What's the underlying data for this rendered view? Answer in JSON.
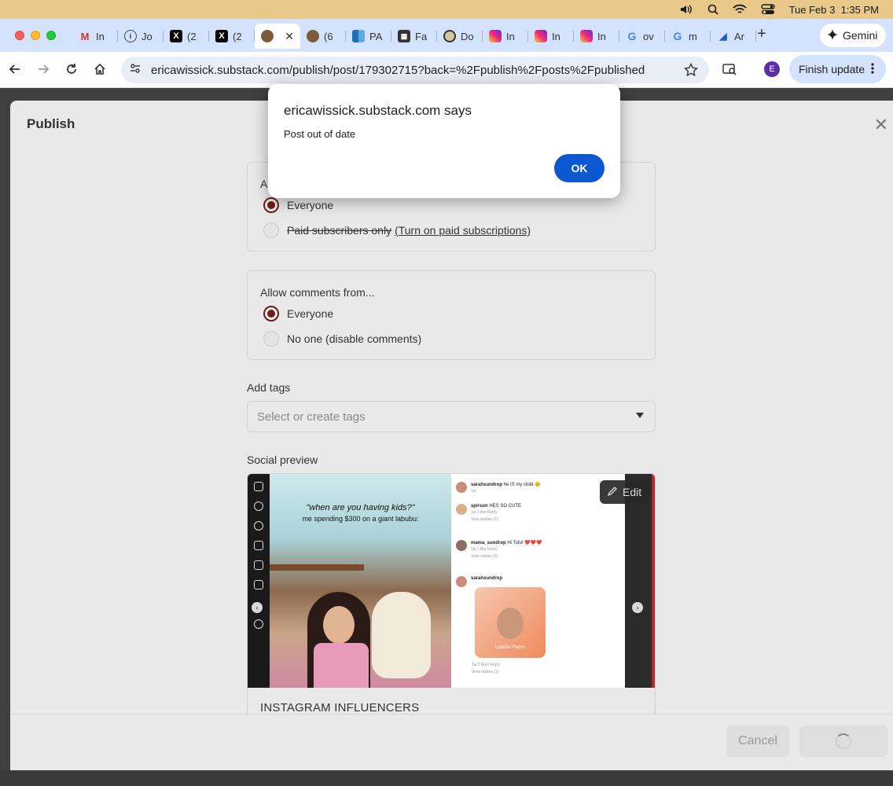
{
  "menubar": {
    "datetime": "Tue Feb 3  1:35 PM"
  },
  "tabs": [
    {
      "label": "In",
      "icon": "gmail-icon"
    },
    {
      "label": "Jo",
      "icon": "info-icon"
    },
    {
      "label": "(2",
      "icon": "x-icon"
    },
    {
      "label": "(2",
      "icon": "x-icon"
    },
    {
      "label": "",
      "icon": "cat-icon",
      "active": true
    },
    {
      "label": "(6",
      "icon": "cat-icon"
    },
    {
      "label": "PA",
      "icon": "grid-icon"
    },
    {
      "label": "Fa",
      "icon": "calendar-icon"
    },
    {
      "label": "Do",
      "icon": "owl-icon"
    },
    {
      "label": "In",
      "icon": "instagram-icon"
    },
    {
      "label": "In",
      "icon": "instagram-icon"
    },
    {
      "label": "In",
      "icon": "instagram-icon"
    },
    {
      "label": "ov",
      "icon": "google-icon"
    },
    {
      "label": "m",
      "icon": "google-icon"
    },
    {
      "label": "Ar",
      "icon": "azure-icon"
    }
  ],
  "browser": {
    "gemini_label": "Gemini",
    "url": "ericawissick.substack.com/publish/post/179302715?back=%2Fpublish%2Fposts%2Fpublished",
    "avatar_letter": "E",
    "finish_update_label": "Finish update"
  },
  "modal": {
    "title": "Publish",
    "audience": {
      "heading_partial": "A",
      "option_everyone": "Everyone",
      "option_paid": "Paid subscribers only",
      "paid_link": "(Turn on paid subscriptions)"
    },
    "comments": {
      "heading": "Allow comments from...",
      "option_everyone": "Everyone",
      "option_none": "No one (disable comments)"
    },
    "tags": {
      "label": "Add tags",
      "placeholder": "Select or create tags"
    },
    "social": {
      "label": "Social preview",
      "edit_label": "Edit",
      "post_title": "INSTAGRAM INFLUENCERS",
      "caption_1": "\"when are you having kids?\"",
      "caption_2": "me spending $300 on a giant labubu:",
      "comments": [
        {
          "user": "sarahsundrop",
          "text": "he IS my child 😊",
          "meta": "1w"
        },
        {
          "user": "spirson",
          "text": "HES SO CUTE",
          "meta": "1w   1 like   Reply",
          "replies": "View replies (1)"
        },
        {
          "user": "mama_sundrop",
          "text": "Hi Tofu! ❤️❤️❤️",
          "meta": "1w   1 like   Reply",
          "replies": "View replies (1)"
        },
        {
          "user": "sarahsundrop",
          "text": "",
          "meta": "1w   5 likes   Reply",
          "replies": "View replies (1)"
        }
      ],
      "sticker_text": "Labubu Pedro"
    },
    "cancel_label": "Cancel"
  },
  "alert": {
    "title": "ericawissick.substack.com says",
    "message": "Post out of date",
    "ok_label": "OK"
  },
  "colors": {
    "accent_blue": "#0b57d0",
    "radio_selected": "#6b1d1d",
    "tabstrip": "#d3e3fd"
  }
}
